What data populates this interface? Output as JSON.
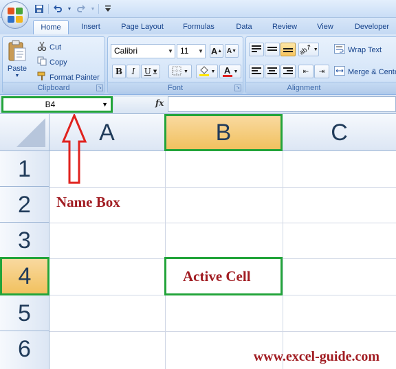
{
  "colors": {
    "accent_green": "#22a43a",
    "annotation_red": "#a11c22",
    "selected_header": "#f6c96f"
  },
  "quick_access": {
    "icons": [
      "save-icon",
      "undo-icon",
      "redo-icon",
      "customize-icon"
    ]
  },
  "tabs": [
    "Home",
    "Insert",
    "Page Layout",
    "Formulas",
    "Data",
    "Review",
    "View",
    "Developer"
  ],
  "active_tab": "Home",
  "clipboard": {
    "paste": "Paste",
    "cut": "Cut",
    "copy": "Copy",
    "format_painter": "Format Painter",
    "label": "Clipboard"
  },
  "font": {
    "name": "Calibri",
    "size": "11",
    "bold": "B",
    "italic": "I",
    "underline": "U",
    "font_color_glyph": "A",
    "grow_glyph": "A",
    "shrink_glyph": "A",
    "label": "Font"
  },
  "alignment": {
    "wrap_text": "Wrap Text",
    "merge_center": "Merge & Center",
    "label": "Alignment"
  },
  "formula_bar": {
    "name_box": "B4",
    "fx": "fx",
    "formula": ""
  },
  "grid": {
    "columns": [
      "A",
      "B",
      "C"
    ],
    "rows": [
      "1",
      "2",
      "3",
      "4",
      "5",
      "6"
    ],
    "selected_column": "B",
    "selected_row": "4"
  },
  "annotations": {
    "name_box_label": "Name Box",
    "active_cell_label": "Active Cell"
  },
  "watermark": "www.excel-guide.com"
}
